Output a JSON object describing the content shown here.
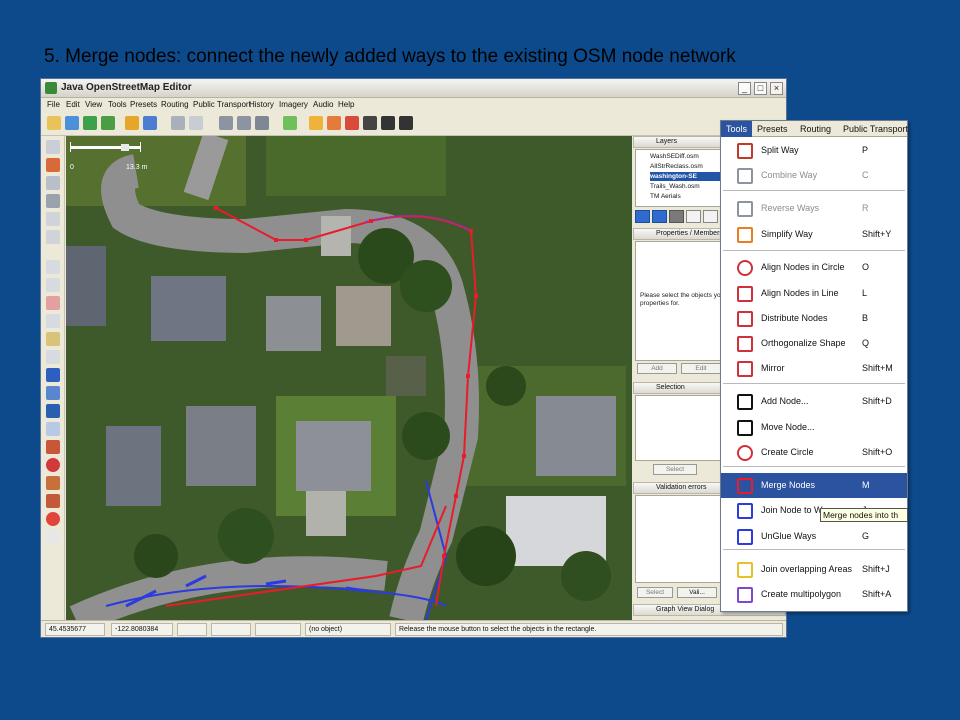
{
  "slide": {
    "title": "5. Merge nodes: connect the newly added ways to the existing OSM node network"
  },
  "window": {
    "title": "Java OpenStreetMap Editor",
    "minimize": "_",
    "maximize": "□",
    "close": "×"
  },
  "menubar": [
    "File",
    "Edit",
    "View",
    "Tools",
    "Presets",
    "Routing",
    "Public Transport",
    "History",
    "Imagery",
    "Audio",
    "Help"
  ],
  "map": {
    "scale_label": "13.3 m",
    "scale_zero": "0"
  },
  "layers_panel": {
    "title": "Layers",
    "layers": [
      "WashSEDiff.osm",
      "AllStrReclass.osm",
      "washington-SE",
      "Trails_Wash.osm",
      "TM Aerials"
    ],
    "selected_index": 2
  },
  "properties_panel": {
    "title": "Properties / Members",
    "hint": "Please select the objects you want to change properties for.",
    "add_label": "Add",
    "edit_label": "Edit"
  },
  "selection_panel": {
    "title": "Selection",
    "select_label": "Select"
  },
  "validation_panel": {
    "title": "Validation errors",
    "select_label": "Select",
    "validate_label": "Vali..."
  },
  "graph_view": {
    "title": "Graph View Dialog"
  },
  "statusbar": {
    "lat": "45.4535677",
    "lon": "-122.8080384",
    "object": "(no object)",
    "message": "Release the mouse button to select the objects in the rectangle."
  },
  "tools_menu": {
    "menubar": [
      "Tools",
      "Presets",
      "Routing",
      "Public Transport"
    ],
    "items": [
      {
        "label": "Split Way",
        "shortcut": "P",
        "icon": "split-way-icon",
        "enabled": true
      },
      {
        "label": "Combine Way",
        "shortcut": "C",
        "icon": "combine-way-icon",
        "enabled": false
      },
      {
        "label": "Reverse Ways",
        "shortcut": "R",
        "icon": "reverse-ways-icon",
        "enabled": false
      },
      {
        "label": "Simplify Way",
        "shortcut": "Shift+Y",
        "icon": "simplify-way-icon",
        "enabled": true
      },
      {
        "label": "Align Nodes in Circle",
        "shortcut": "O",
        "icon": "align-circle-icon",
        "enabled": true
      },
      {
        "label": "Align Nodes in Line",
        "shortcut": "L",
        "icon": "align-line-icon",
        "enabled": true
      },
      {
        "label": "Distribute Nodes",
        "shortcut": "B",
        "icon": "distribute-nodes-icon",
        "enabled": true
      },
      {
        "label": "Orthogonalize Shape",
        "shortcut": "Q",
        "icon": "orthogonalize-icon",
        "enabled": true
      },
      {
        "label": "Mirror",
        "shortcut": "Shift+M",
        "icon": "mirror-icon",
        "enabled": true
      },
      {
        "label": "Add Node...",
        "shortcut": "Shift+D",
        "icon": "add-node-icon",
        "enabled": true
      },
      {
        "label": "Move Node...",
        "shortcut": "",
        "icon": "move-node-icon",
        "enabled": true
      },
      {
        "label": "Create Circle",
        "shortcut": "Shift+O",
        "icon": "create-circle-icon",
        "enabled": true
      },
      {
        "label": "Merge Nodes",
        "shortcut": "M",
        "icon": "merge-nodes-icon",
        "enabled": true,
        "highlighted": true
      },
      {
        "label": "Join Node to Way",
        "shortcut": "J",
        "icon": "join-node-icon",
        "enabled": true
      },
      {
        "label": "UnGlue Ways",
        "shortcut": "G",
        "icon": "unglue-ways-icon",
        "enabled": true
      },
      {
        "label": "Join overlapping Areas",
        "shortcut": "Shift+J",
        "icon": "join-areas-icon",
        "enabled": true
      },
      {
        "label": "Create multipolygon",
        "shortcut": "Shift+A",
        "icon": "multipolygon-icon",
        "enabled": true
      }
    ]
  },
  "tooltip": {
    "text": "Merge nodes into th"
  },
  "colors": {
    "slide_bg": "#0d4a8c",
    "menu_highlight": "#2b53a0",
    "way_red": "#e81c2a",
    "way_blue": "#2b3be0"
  }
}
